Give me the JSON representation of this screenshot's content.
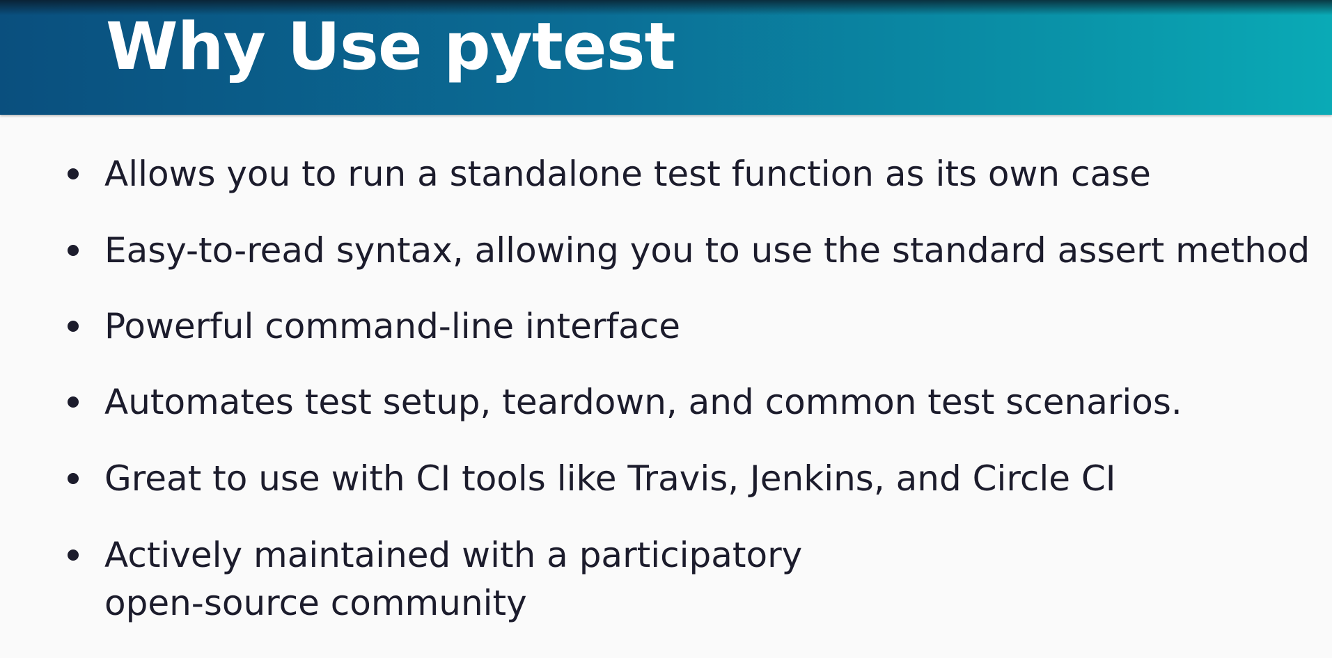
{
  "slide": {
    "title": "Why Use pytest",
    "bullets": [
      {
        "text": "Allows you to run a standalone test function as its own case"
      },
      {
        "text": "Easy-to-read syntax, allowing you to use the standard assert method"
      },
      {
        "text": "Powerful command-line interface"
      },
      {
        "text": "Automates test setup, teardown, and common test scenarios."
      },
      {
        "text": "Great to use with CI tools like Travis, Jenkins, and Circle CI"
      },
      {
        "text": "Actively maintained with a participatory",
        "text_line2": "open-source community"
      }
    ]
  },
  "colors": {
    "header_start": "#0a4f7e",
    "header_end": "#0aaab6",
    "title_text": "#ffffff",
    "body_text": "#1c1c2c",
    "background": "#fafafa"
  }
}
